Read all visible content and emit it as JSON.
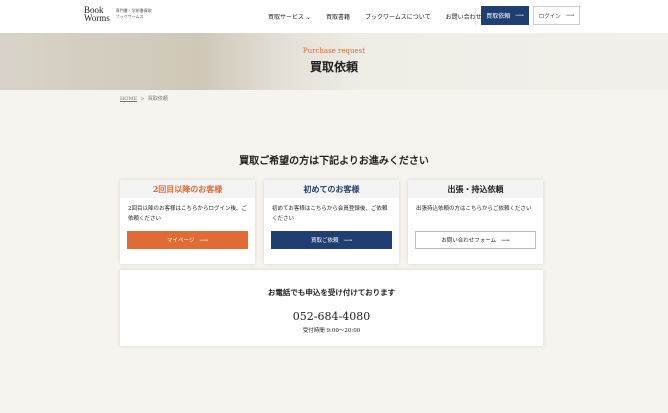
{
  "header": {
    "logo_line1": "Book",
    "logo_line2": "Worms",
    "logo_sub1": "専門書・学術書買取",
    "logo_sub2": "ブックワームス",
    "nav": [
      {
        "label": "買取サービス ⌄"
      },
      {
        "label": "買取書籍"
      },
      {
        "label": "ブックワームスについて"
      },
      {
        "label": "お問い合わせ"
      }
    ],
    "request_button": "買取依頼",
    "login_button": "ログイン"
  },
  "hero": {
    "en": "Purchase request",
    "ja": "買取依頼"
  },
  "breadcrumb": {
    "home": "HOME",
    "sep": ">",
    "current": "買取依頼"
  },
  "main": {
    "title": "買取ご希望の方は下記よりお進みください",
    "cards": [
      {
        "title": "2回目以降のお客様",
        "desc": "2回目以降のお客様はこちらからログイン後、ご依頼ください",
        "button": "マイページ",
        "color": "#e06b35"
      },
      {
        "title": "初めてのお客様",
        "desc": "初めてお客様はこちらから会員登録後、ご依頼ください",
        "button": "買取ご依頼",
        "color": "#1f3f73"
      },
      {
        "title": "出張・持込依頼",
        "desc": "出張持込依頼の方はこちらからご依頼ください",
        "button": "お問い合わせフォーム",
        "color": "#222222"
      }
    ],
    "phone": {
      "heading": "お電話でも申込を受け付けております",
      "number": "052-684-4080",
      "hours": "受付時間 9:00〜20:00"
    }
  }
}
